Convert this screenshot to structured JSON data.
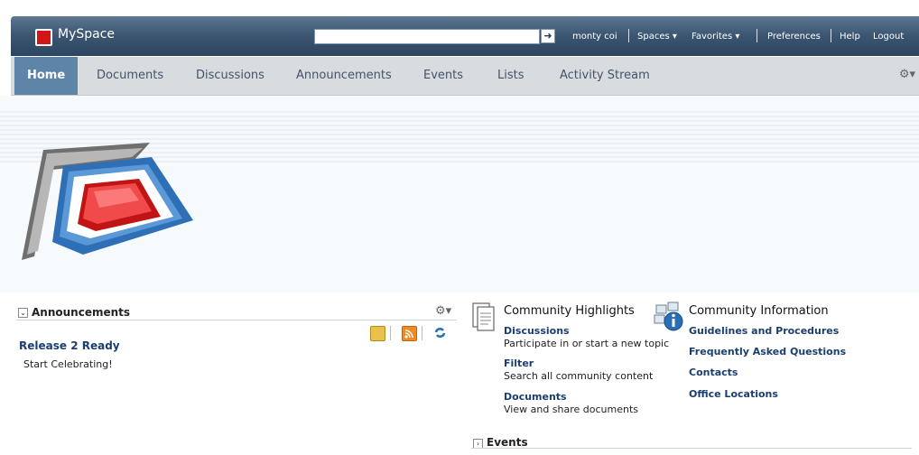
{
  "header": {
    "brand": "MySpace",
    "search": {
      "value": "",
      "placeholder": ""
    },
    "user": "monty coi",
    "spaces": "Spaces ▾",
    "favorites": "Favorites ▾",
    "preferences": "Preferences",
    "help": "Help",
    "logout": "Logout"
  },
  "nav": {
    "tabs": [
      {
        "label": "Home",
        "active": true
      },
      {
        "label": "Documents"
      },
      {
        "label": "Discussions"
      },
      {
        "label": "Announcements"
      },
      {
        "label": "Events"
      },
      {
        "label": "Lists"
      },
      {
        "label": "Activity Stream"
      }
    ],
    "settings_icon": "gear-icon"
  },
  "announcements": {
    "title": "Announcements",
    "items": [
      {
        "title": "Release 2 Ready",
        "description": "Start Celebrating!"
      }
    ],
    "tools": [
      "edit-icon",
      "rss-icon",
      "refresh-icon"
    ]
  },
  "highlights": {
    "title": "Community Highlights",
    "items": [
      {
        "label": "Discussions",
        "description": "Participate in or start a new topic"
      },
      {
        "label": "Filter",
        "description": "Search all community content"
      },
      {
        "label": "Documents",
        "description": "View and share documents"
      }
    ]
  },
  "information": {
    "title": "Community Information",
    "links": [
      "Guidelines and Procedures",
      "Frequently Asked Questions",
      "Contacts",
      "Office Locations"
    ]
  },
  "events": {
    "title": "Events"
  },
  "colors": {
    "header_bg": "#3c5571",
    "active_tab": "#5d85a8",
    "link": "#1b3e70",
    "brand_red": "#d31515"
  }
}
